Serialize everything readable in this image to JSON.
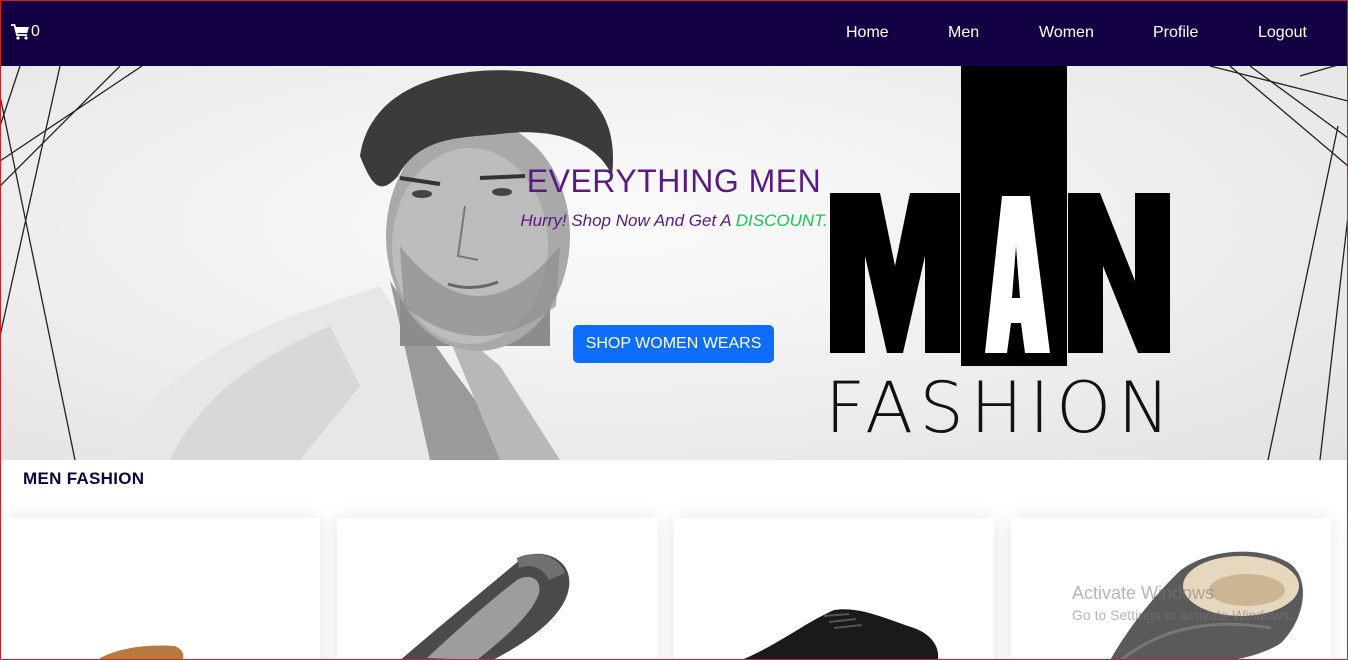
{
  "navbar": {
    "cart_count": "0",
    "links": [
      "Home",
      "Men",
      "Women",
      "Profile",
      "Logout"
    ],
    "background": "#130042"
  },
  "hero": {
    "title": "EVERYTHING MEN",
    "subtitle": "Hurry! Shop Now And Get A ",
    "discount": "DISCOUNT.",
    "button": "SHOP WOMEN WEARS",
    "logo_top": "MAN",
    "logo_bottom": "FASHION",
    "title_color": "#5a1a84",
    "discount_color": "#1fbf55",
    "button_color": "#0d6efd"
  },
  "section": {
    "title": "MEN FASHION"
  },
  "products": [
    {
      "image": "brown-shoe-image"
    },
    {
      "image": "grey-slipper-image"
    },
    {
      "image": "black-sneaker-image"
    },
    {
      "image": "fur-slipper-image"
    }
  ],
  "watermark": {
    "line1": "Activate Windows",
    "line2": "Go to Settings to activate Windows."
  }
}
